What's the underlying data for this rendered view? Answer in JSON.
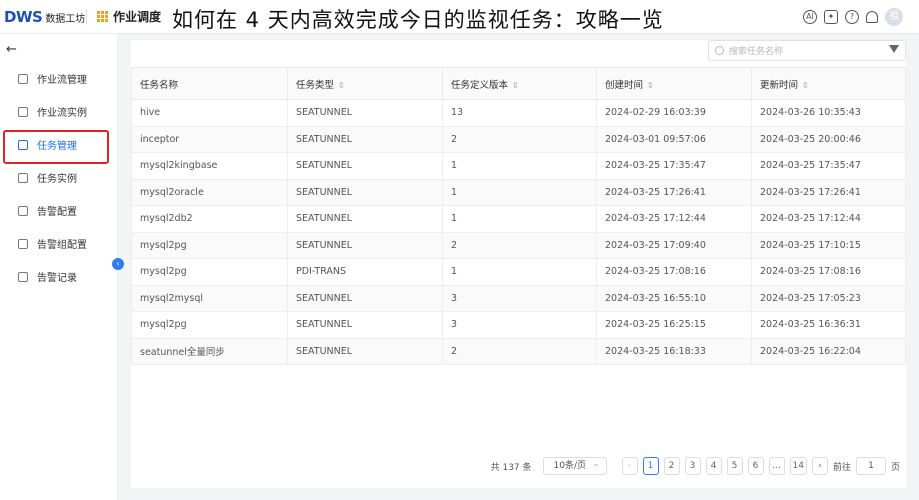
{
  "header": {
    "logo_mark": "DWS",
    "logo_sub": "数据工坊",
    "module": "作业调度",
    "headline": "如何在 4 天内高效完成今日的监视任务：攻略一览",
    "avatar": "祖"
  },
  "sidebar": {
    "items": [
      {
        "label": "作业流管理",
        "icon": "workflow-icon"
      },
      {
        "label": "作业流实例",
        "icon": "instance-icon"
      },
      {
        "label": "任务管理",
        "icon": "task-icon",
        "active": true
      },
      {
        "label": "任务实例",
        "icon": "task-instance-icon"
      },
      {
        "label": "告警配置",
        "icon": "alarm-icon"
      },
      {
        "label": "告警组配置",
        "icon": "alarm-group-icon"
      },
      {
        "label": "告警记录",
        "icon": "alarm-record-icon"
      }
    ]
  },
  "search": {
    "placeholder": "搜索任务名称"
  },
  "table": {
    "columns": [
      "任务名称",
      "任务类型",
      "任务定义版本",
      "创建时间",
      "更新时间"
    ],
    "rows": [
      [
        "hive",
        "SEATUNNEL",
        "13",
        "2024-02-29 16:03:39",
        "2024-03-26 10:35:43"
      ],
      [
        "inceptor",
        "SEATUNNEL",
        "2",
        "2024-03-01 09:57:06",
        "2024-03-25 20:00:46"
      ],
      [
        "mysql2kingbase",
        "SEATUNNEL",
        "1",
        "2024-03-25 17:35:47",
        "2024-03-25 17:35:47"
      ],
      [
        "mysql2oracle",
        "SEATUNNEL",
        "1",
        "2024-03-25 17:26:41",
        "2024-03-25 17:26:41"
      ],
      [
        "mysql2db2",
        "SEATUNNEL",
        "1",
        "2024-03-25 17:12:44",
        "2024-03-25 17:12:44"
      ],
      [
        "mysql2pg",
        "SEATUNNEL",
        "2",
        "2024-03-25 17:09:40",
        "2024-03-25 17:10:15"
      ],
      [
        "mysql2pg",
        "PDI-TRANS",
        "1",
        "2024-03-25 17:08:16",
        "2024-03-25 17:08:16"
      ],
      [
        "mysql2mysql",
        "SEATUNNEL",
        "3",
        "2024-03-25 16:55:10",
        "2024-03-25 17:05:23"
      ],
      [
        "mysql2pg",
        "SEATUNNEL",
        "3",
        "2024-03-25 16:25:15",
        "2024-03-25 16:36:31"
      ],
      [
        "seatunnel全量同步",
        "SEATUNNEL",
        "2",
        "2024-03-25 16:18:33",
        "2024-03-25 16:22:04"
      ]
    ]
  },
  "pagination": {
    "total": "共 137 条",
    "page_size": "10条/页",
    "pages": [
      "1",
      "2",
      "3",
      "4",
      "5",
      "6",
      "...",
      "14"
    ],
    "current": "1",
    "jump_label": "前往",
    "jump_value": "1",
    "page_unit": "页"
  }
}
